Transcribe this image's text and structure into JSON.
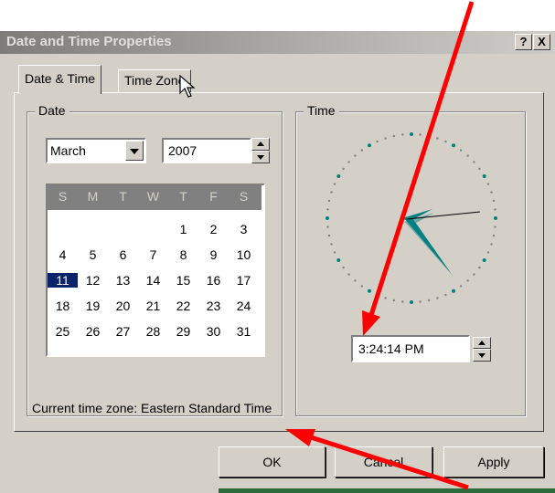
{
  "window": {
    "title": "Date and Time Properties",
    "help_label": "?",
    "close_label": "X"
  },
  "tabs": [
    {
      "label": "Date & Time"
    },
    {
      "label": "Time Zone"
    }
  ],
  "date_group": {
    "legend": "Date",
    "month": "March",
    "year": "2007",
    "weekdays": [
      "S",
      "M",
      "T",
      "W",
      "T",
      "F",
      "S"
    ],
    "weeks": [
      [
        "",
        "",
        "",
        "",
        "1",
        "2",
        "3"
      ],
      [
        "4",
        "5",
        "6",
        "7",
        "8",
        "9",
        "10"
      ],
      [
        "11",
        "12",
        "13",
        "14",
        "15",
        "16",
        "17"
      ],
      [
        "18",
        "19",
        "20",
        "21",
        "22",
        "23",
        "24"
      ],
      [
        "25",
        "26",
        "27",
        "28",
        "29",
        "30",
        "31"
      ]
    ],
    "selected_day": "11"
  },
  "time_group": {
    "legend": "Time",
    "time_value": "3:24:14 PM"
  },
  "timezone_text": "Current time zone:  Eastern Standard Time",
  "buttons": {
    "ok": "OK",
    "cancel": "Cancel",
    "apply": "Apply"
  },
  "colors": {
    "accent": "#0a246a",
    "annotation_arrow": "#ff0000",
    "clock_hand": "#008080"
  }
}
